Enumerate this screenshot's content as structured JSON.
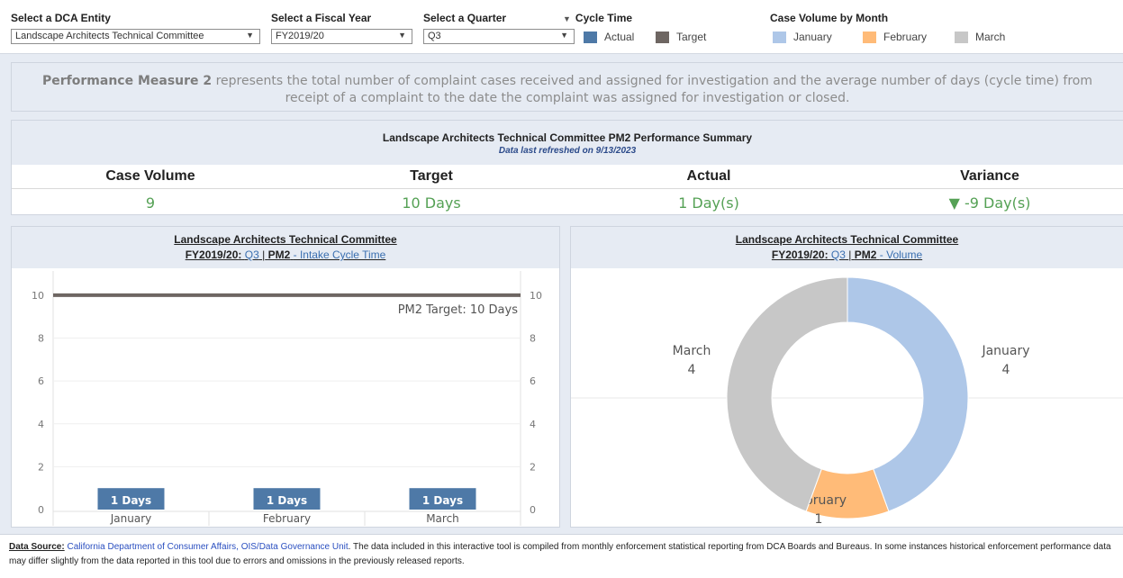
{
  "filters": {
    "entity": {
      "label": "Select a DCA Entity",
      "value": "Landscape Architects Technical Committee"
    },
    "fiscal_year": {
      "label": "Select a Fiscal Year",
      "value": "FY2019/20"
    },
    "quarter": {
      "label": "Select a Quarter",
      "value": "Q3"
    }
  },
  "cycle_time_legend": {
    "title": "Cycle Time",
    "items": [
      {
        "label": "Actual",
        "color": "#4e79a7"
      },
      {
        "label": "Target",
        "color": "#6e6662"
      }
    ]
  },
  "volume_legend": {
    "title": "Case Volume by Month",
    "items": [
      {
        "label": "January",
        "color": "#aec7e8"
      },
      {
        "label": "February",
        "color": "#ffbb78"
      },
      {
        "label": "March",
        "color": "#c7c7c7"
      }
    ]
  },
  "description": {
    "bold": "Performance Measure 2",
    "text": " represents the total number of complaint cases received and assigned for investigation and the average number of days (cycle time) from receipt of a complaint to the date the complaint was assigned for investigation or closed."
  },
  "summary": {
    "title": "Landscape Architects Technical Committee PM2 Performance Summary",
    "refreshed": "Data last refreshed on 9/13/2023",
    "columns": [
      {
        "header": "Case Volume",
        "value": "9"
      },
      {
        "header": "Target",
        "value": "10 Days"
      },
      {
        "header": "Actual",
        "value": "1 Day(s)"
      },
      {
        "header": "Variance",
        "value": "▼ -9 Day(s)"
      }
    ]
  },
  "cycle_chart": {
    "title": "Landscape Architects Technical Committee",
    "fy": "FY2019/20",
    "sep1": ":",
    "quarter": "Q3",
    "sep2": "|",
    "pm": "PM2",
    "metric": "- Intake Cycle Time",
    "target_label": "PM2 Target: 10 Days"
  },
  "volume_chart": {
    "title": "Landscape Architects Technical Committee",
    "fy": "FY2019/20",
    "sep1": ":",
    "quarter": "Q3",
    "sep2": "|",
    "pm": "PM2",
    "metric": "- Volume"
  },
  "chart_data": [
    {
      "type": "bar",
      "categories": [
        "January",
        "February",
        "March"
      ],
      "values": [
        1,
        1,
        1
      ],
      "bar_labels": [
        "1 Days",
        "1 Days",
        "1 Days"
      ],
      "target": 10,
      "ylim": [
        0,
        10.5
      ],
      "yticks": [
        0,
        2,
        4,
        6,
        8,
        10
      ],
      "bar_color": "#4e79a7",
      "target_color": "#6e6662"
    },
    {
      "type": "pie",
      "donut": true,
      "slices": [
        {
          "label": "January",
          "value": 4,
          "color": "#aec7e8"
        },
        {
          "label": "February",
          "value": 1,
          "color": "#ffbb78"
        },
        {
          "label": "March",
          "value": 4,
          "color": "#c7c7c7"
        }
      ]
    }
  ],
  "footer": {
    "label": "Data Source:",
    "source": "California Department of Consumer Affairs, OIS/Data Governance Unit",
    "text": ".  The data included in this interactive tool is compiled from monthly enforcement statistical reporting from DCA Boards and Bureaus.  In some instances historical enforcement performance data may differ slightly from the data reported in this tool due to errors and omissions in the previously released reports."
  }
}
